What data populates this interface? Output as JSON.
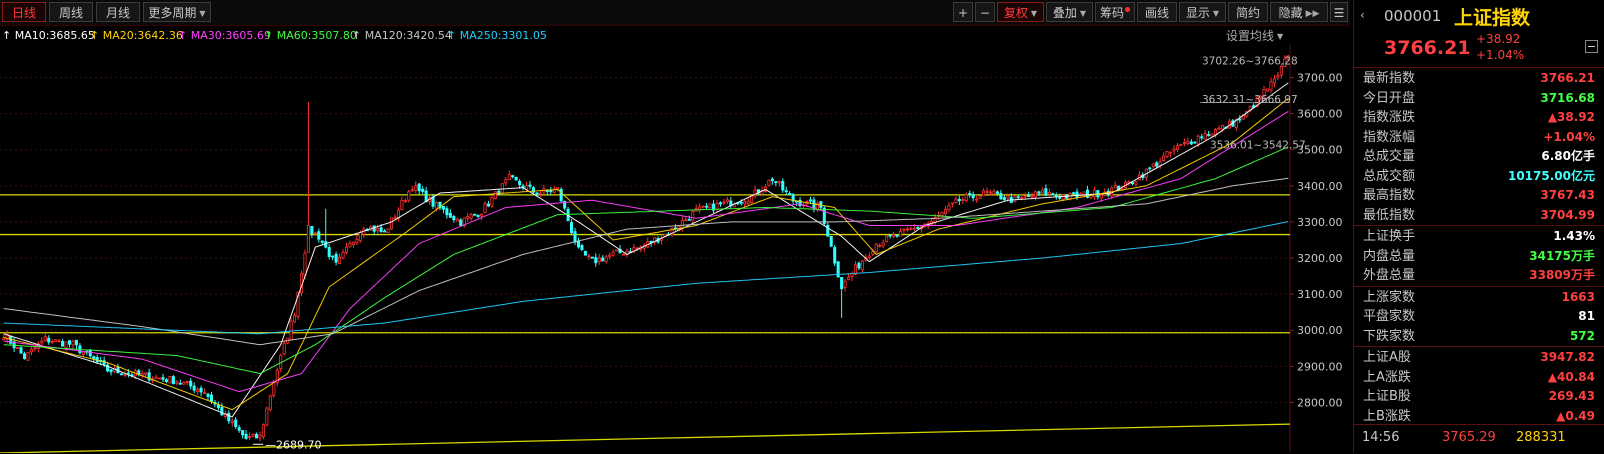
{
  "toolbar": {
    "period_tabs": [
      "日线",
      "周线",
      "月线",
      "更多周期"
    ],
    "zoom_in": "+",
    "zoom_out": "−",
    "buttons": [
      "复权",
      "叠加",
      "筹码",
      "画线",
      "显示",
      "简约",
      "隐藏"
    ]
  },
  "set_ma": "设置均线",
  "moving_averages": [
    {
      "label": "MA10:3685.65",
      "color": "#ffffff"
    },
    {
      "label": "MA20:3642.36",
      "color": "#ffd400"
    },
    {
      "label": "MA30:3605.69",
      "color": "#ff40ff"
    },
    {
      "label": "MA60:3507.80",
      "color": "#40ff40"
    },
    {
      "label": "MA120:3420.54",
      "color": "#c8c8c8"
    },
    {
      "label": "MA250:3301.05",
      "color": "#20d0ff"
    }
  ],
  "stock": {
    "code": "000001",
    "name": "上证指数",
    "price": "3766.21",
    "change": "+38.92",
    "change_pct": "+1.04%"
  },
  "stats": [
    {
      "label": "最新指数",
      "value": "3766.21",
      "color": "#ff4040",
      "group": 1
    },
    {
      "label": "今日开盘",
      "value": "3716.68",
      "color": "#40ff40",
      "group": 1
    },
    {
      "label": "指数涨跌",
      "value": "▲38.92",
      "color": "#ff4040",
      "group": 1
    },
    {
      "label": "指数涨幅",
      "value": "+1.04%",
      "color": "#ff4040",
      "group": 1
    },
    {
      "label": "总成交量",
      "value": "6.80亿手",
      "color": "#ffffff",
      "group": 1
    },
    {
      "label": "总成交额",
      "value": "10175.00亿元",
      "color": "#40ffff",
      "group": 1
    },
    {
      "label": "最高指数",
      "value": "3767.43",
      "color": "#ff4040",
      "group": 1
    },
    {
      "label": "最低指数",
      "value": "3704.99",
      "color": "#ff4040",
      "group": 1
    },
    {
      "label": "上证换手",
      "value": "1.43%",
      "color": "#ffffff",
      "group": 2
    },
    {
      "label": "内盘总量",
      "value": "34175万手",
      "color": "#40ff40",
      "group": 2
    },
    {
      "label": "外盘总量",
      "value": "33809万手",
      "color": "#ff4040",
      "group": 2
    },
    {
      "label": "上涨家数",
      "value": "1663",
      "color": "#ff4040",
      "group": 3
    },
    {
      "label": "平盘家数",
      "value": "81",
      "color": "#ffffff",
      "group": 3
    },
    {
      "label": "下跌家数",
      "value": "572",
      "color": "#40ff40",
      "group": 3
    },
    {
      "label": "上证A股",
      "value": "3947.82",
      "color": "#ff4040",
      "group": 4
    },
    {
      "label": "上A涨跌",
      "value": "▲40.84",
      "color": "#ff4040",
      "group": 4
    },
    {
      "label": "上证B股",
      "value": "269.43",
      "color": "#ff4040",
      "group": 4
    },
    {
      "label": "上B涨跌",
      "value": "▲0.49",
      "color": "#ff4040",
      "group": 4
    }
  ],
  "footer": {
    "time": "14:56",
    "price": "3765.29",
    "volume": "288331"
  },
  "chart_data": {
    "type": "candlestick",
    "y_ticks": [
      "3700.00",
      "3600.00",
      "3500.00",
      "3400.00",
      "3300.00",
      "3200.00",
      "3100.00",
      "3000.00",
      "2900.00",
      "2800.00"
    ],
    "ylim": [
      2660,
      3790
    ],
    "grid": true,
    "annotations": {
      "high": "3767.43",
      "low": "2689.70",
      "range1": "3702.26~3766.28",
      "range2": "3632.31~3666.97",
      "range3": "3536.01~3542.57"
    },
    "horizontal_levels": [
      3375,
      3265,
      2993
    ],
    "trend_line": {
      "from": 2660,
      "to": 2668
    },
    "series_close_anchors": [
      [
        0,
        2990
      ],
      [
        6,
        2925
      ],
      [
        12,
        2975
      ],
      [
        20,
        2960
      ],
      [
        30,
        2890
      ],
      [
        40,
        2875
      ],
      [
        50,
        2860
      ],
      [
        58,
        2830
      ],
      [
        64,
        2760
      ],
      [
        70,
        2700
      ],
      [
        74,
        2705
      ],
      [
        78,
        2860
      ],
      [
        84,
        3050
      ],
      [
        88,
        3280
      ],
      [
        91,
        3260
      ],
      [
        96,
        3180
      ],
      [
        104,
        3290
      ],
      [
        110,
        3270
      ],
      [
        118,
        3400
      ],
      [
        124,
        3350
      ],
      [
        132,
        3300
      ],
      [
        138,
        3330
      ],
      [
        146,
        3420
      ],
      [
        154,
        3380
      ],
      [
        160,
        3390
      ],
      [
        166,
        3220
      ],
      [
        170,
        3190
      ],
      [
        176,
        3210
      ],
      [
        184,
        3230
      ],
      [
        192,
        3270
      ],
      [
        200,
        3330
      ],
      [
        208,
        3350
      ],
      [
        216,
        3370
      ],
      [
        222,
        3420
      ],
      [
        228,
        3360
      ],
      [
        236,
        3340
      ],
      [
        242,
        3120
      ],
      [
        246,
        3170
      ],
      [
        252,
        3240
      ],
      [
        260,
        3270
      ],
      [
        268,
        3300
      ],
      [
        276,
        3360
      ],
      [
        284,
        3380
      ],
      [
        292,
        3360
      ],
      [
        300,
        3380
      ],
      [
        308,
        3370
      ],
      [
        316,
        3380
      ],
      [
        324,
        3400
      ],
      [
        330,
        3440
      ],
      [
        338,
        3500
      ],
      [
        346,
        3540
      ],
      [
        352,
        3560
      ],
      [
        358,
        3590
      ],
      [
        364,
        3660
      ],
      [
        368,
        3700
      ],
      [
        371,
        3766
      ]
    ],
    "ma_series": [
      {
        "name": "MA10",
        "color": "#ffffff",
        "anchors": [
          [
            0,
            2990
          ],
          [
            30,
            2900
          ],
          [
            66,
            2760
          ],
          [
            80,
            2960
          ],
          [
            90,
            3230
          ],
          [
            112,
            3300
          ],
          [
            126,
            3380
          ],
          [
            150,
            3395
          ],
          [
            166,
            3300
          ],
          [
            180,
            3210
          ],
          [
            200,
            3300
          ],
          [
            220,
            3390
          ],
          [
            242,
            3260
          ],
          [
            250,
            3190
          ],
          [
            266,
            3290
          ],
          [
            290,
            3360
          ],
          [
            320,
            3380
          ],
          [
            350,
            3540
          ],
          [
            371,
            3685
          ]
        ]
      },
      {
        "name": "MA20",
        "color": "#ffd400",
        "anchors": [
          [
            0,
            2980
          ],
          [
            30,
            2910
          ],
          [
            66,
            2780
          ],
          [
            82,
            2880
          ],
          [
            94,
            3120
          ],
          [
            116,
            3270
          ],
          [
            130,
            3370
          ],
          [
            160,
            3390
          ],
          [
            176,
            3250
          ],
          [
            200,
            3290
          ],
          [
            222,
            3370
          ],
          [
            240,
            3340
          ],
          [
            252,
            3210
          ],
          [
            270,
            3280
          ],
          [
            300,
            3350
          ],
          [
            330,
            3400
          ],
          [
            355,
            3520
          ],
          [
            371,
            3642
          ]
        ]
      },
      {
        "name": "MA30",
        "color": "#ff40ff",
        "anchors": [
          [
            0,
            2970
          ],
          [
            40,
            2920
          ],
          [
            68,
            2830
          ],
          [
            86,
            2880
          ],
          [
            100,
            3060
          ],
          [
            120,
            3240
          ],
          [
            145,
            3340
          ],
          [
            170,
            3360
          ],
          [
            200,
            3310
          ],
          [
            230,
            3350
          ],
          [
            250,
            3290
          ],
          [
            275,
            3290
          ],
          [
            310,
            3340
          ],
          [
            340,
            3420
          ],
          [
            371,
            3606
          ]
        ]
      },
      {
        "name": "MA60",
        "color": "#40ff40",
        "anchors": [
          [
            0,
            2960
          ],
          [
            50,
            2930
          ],
          [
            74,
            2880
          ],
          [
            90,
            2960
          ],
          [
            110,
            3090
          ],
          [
            130,
            3210
          ],
          [
            160,
            3320
          ],
          [
            190,
            3330
          ],
          [
            220,
            3340
          ],
          [
            250,
            3330
          ],
          [
            280,
            3310
          ],
          [
            320,
            3340
          ],
          [
            350,
            3420
          ],
          [
            371,
            3508
          ]
        ]
      },
      {
        "name": "MA120",
        "color": "#c8c8c8",
        "anchors": [
          [
            0,
            3060
          ],
          [
            40,
            3010
          ],
          [
            74,
            2960
          ],
          [
            95,
            2990
          ],
          [
            120,
            3110
          ],
          [
            150,
            3210
          ],
          [
            180,
            3280
          ],
          [
            210,
            3300
          ],
          [
            240,
            3300
          ],
          [
            270,
            3310
          ],
          [
            300,
            3330
          ],
          [
            330,
            3350
          ],
          [
            355,
            3400
          ],
          [
            371,
            3421
          ]
        ]
      },
      {
        "name": "MA250",
        "color": "#20d0ff",
        "anchors": [
          [
            0,
            3020
          ],
          [
            74,
            2990
          ],
          [
            110,
            3020
          ],
          [
            150,
            3080
          ],
          [
            200,
            3130
          ],
          [
            250,
            3160
          ],
          [
            300,
            3200
          ],
          [
            340,
            3240
          ],
          [
            371,
            3301
          ]
        ]
      }
    ]
  }
}
